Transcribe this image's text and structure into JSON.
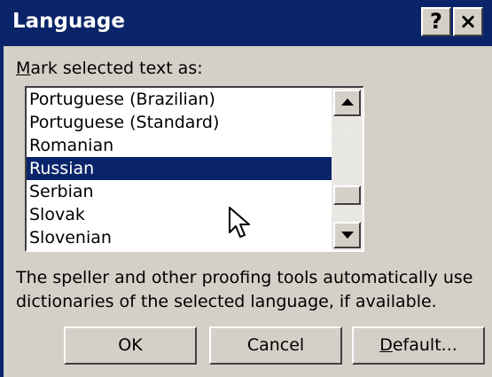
{
  "window": {
    "title": "Language",
    "help_label": "?",
    "close_label": "×",
    "colors": {
      "titlebar": "#0A246A",
      "face": "#D4D0C8",
      "selection": "#0A246A"
    }
  },
  "prompt": {
    "accel": "M",
    "rest": "ark selected text as:"
  },
  "languages": [
    "Portuguese (Brazilian)",
    "Portuguese (Standard)",
    "Romanian",
    "Russian",
    "Serbian",
    "Slovak",
    "Slovenian"
  ],
  "selected_language": "Russian",
  "scrollbar": {
    "up_icon": "arrow-up-icon",
    "down_icon": "arrow-down-icon"
  },
  "info_text": "The speller and other proofing tools automatically use dictionaries of the selected language, if available.",
  "buttons": {
    "ok": "OK",
    "cancel": "Cancel",
    "default_accel": "D",
    "default_rest": "efault..."
  }
}
